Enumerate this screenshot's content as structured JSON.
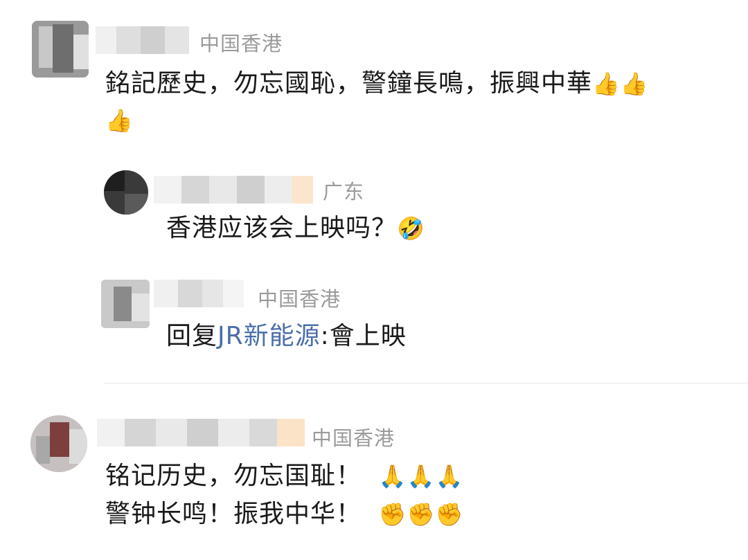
{
  "comments": [
    {
      "location": "中国香港",
      "text_line1": "銘記歷史，勿忘國恥，警鐘長鳴，振興中華",
      "emoji_line1": "👍👍",
      "emoji_line2": "👍"
    },
    {
      "location": "广东",
      "text": "香港应该会上映吗？",
      "emoji": "🤣"
    },
    {
      "location": "中国香港",
      "reply_prefix": "回复",
      "mention": "JR新能源",
      "reply_text": ":會上映"
    },
    {
      "location": "中国香港",
      "text_line1": "铭记历史，勿忘国耻！",
      "emoji_line1": "🙏🙏🙏",
      "text_line2": "警钟长鸣！振我中华！",
      "emoji_line2": "✊✊✊"
    }
  ]
}
